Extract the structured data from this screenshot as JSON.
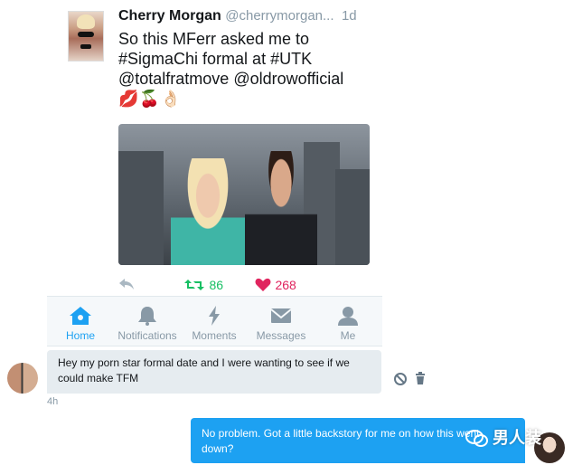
{
  "tweet": {
    "name": "Cherry Morgan",
    "handle": "@cherrymorgan...",
    "time": "1d",
    "text_lines": [
      "So this MFerr asked me to",
      "#SigmaChi formal at #UTK",
      "@totalfratmove @oldrowofficial"
    ],
    "emoji": "💋🍒👌🏻",
    "retweet_count": "86",
    "like_count": "268",
    "colors": {
      "retweet": "#17bf63",
      "like": "#e0245e"
    }
  },
  "nav": {
    "items": [
      {
        "label": "Home",
        "icon": "home-icon",
        "active": true
      },
      {
        "label": "Notifications",
        "icon": "bell-icon",
        "active": false
      },
      {
        "label": "Moments",
        "icon": "lightning-icon",
        "active": false
      },
      {
        "label": "Messages",
        "icon": "envelope-icon",
        "active": false
      },
      {
        "label": "Me",
        "icon": "person-icon",
        "active": false
      }
    ],
    "accent": "#1da1f2"
  },
  "dm": {
    "incoming": {
      "text": "Hey my porn star formal date and I were wanting to see if we could make TFM",
      "time": "4h"
    },
    "outgoing": {
      "text": "No problem. Got a little backstory for me on how this went down?"
    }
  },
  "watermark": {
    "text": "男人装"
  }
}
